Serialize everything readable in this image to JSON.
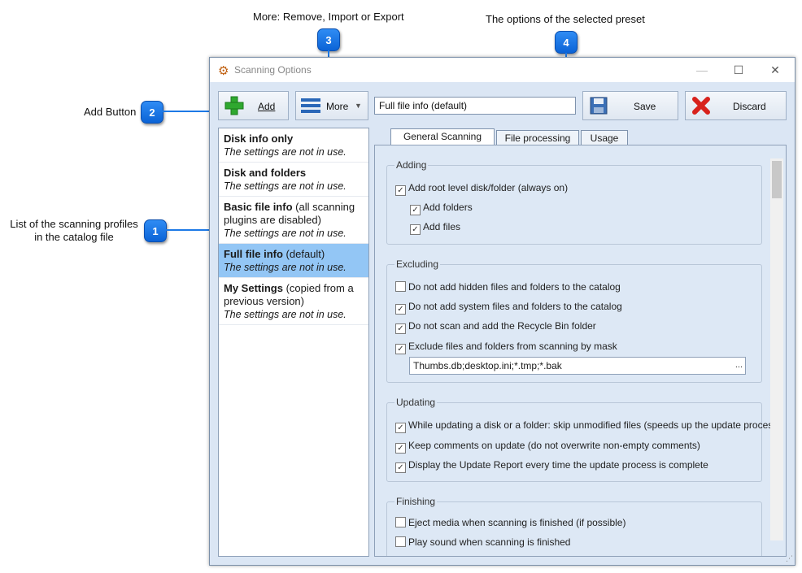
{
  "annotations": {
    "a1": {
      "num": "1",
      "label_line1": "List of the scanning profiles",
      "label_line2": "in the catalog file"
    },
    "a2": {
      "num": "2",
      "label": "Add Button"
    },
    "a3": {
      "num": "3",
      "label": "More: Remove, Import or Export"
    },
    "a4": {
      "num": "4",
      "label": "The options of the selected preset"
    }
  },
  "window": {
    "title": "Scanning Options",
    "minimize": "—",
    "maximize": "☐",
    "close": "✕"
  },
  "toolbar": {
    "add_label": "Add",
    "more_label": "More",
    "preset_name": "Full file info (default)",
    "save_label": "Save",
    "discard_label": "Discard"
  },
  "profiles": [
    {
      "name": "Disk info only",
      "suffix": "",
      "status": "The settings are not in use."
    },
    {
      "name": "Disk and folders",
      "suffix": "",
      "status": "The settings are not in use."
    },
    {
      "name": "Basic file info",
      "suffix": " (all scanning plugins are disabled)",
      "status": "The settings are not in use."
    },
    {
      "name": "Full file info",
      "suffix": " (default)",
      "status": "The settings are not in use."
    },
    {
      "name": "My Settings",
      "suffix": " (copied from a previous version)",
      "status": "The settings are not in use."
    }
  ],
  "tabs": [
    "General Scanning",
    "File processing",
    "Usage"
  ],
  "groups": {
    "adding": {
      "title": "Adding",
      "options": [
        {
          "label": "Add root level disk/folder (always on)",
          "checked": true
        },
        {
          "label": "Add folders",
          "checked": true
        },
        {
          "label": "Add files",
          "checked": true
        }
      ]
    },
    "excluding": {
      "title": "Excluding",
      "options": [
        {
          "label": "Do not add hidden files and folders to the catalog",
          "checked": false
        },
        {
          "label": "Do not add system files and folders to the catalog",
          "checked": true
        },
        {
          "label": "Do not scan and add the Recycle Bin folder",
          "checked": true
        },
        {
          "label": "Exclude files and folders from scanning by mask",
          "checked": true
        }
      ],
      "mask_value": "Thumbs.db;desktop.ini;*.tmp;*.bak",
      "mask_button": "..."
    },
    "updating": {
      "title": "Updating",
      "options": [
        {
          "label": "While updating a disk or a folder: skip unmodified files (speeds up the update process)",
          "checked": true
        },
        {
          "label": "Keep comments on update (do not overwrite non-empty comments)",
          "checked": true
        },
        {
          "label": "Display the Update Report every time the update process is complete",
          "checked": true
        }
      ]
    },
    "finishing": {
      "title": "Finishing",
      "options": [
        {
          "label": "Eject media when scanning is finished (if possible)",
          "checked": false
        },
        {
          "label": "Play sound when scanning is finished",
          "checked": false
        }
      ]
    }
  },
  "colors": {
    "accent": "#1d79e6",
    "selection": "#93c6f5",
    "window_bg": "#dbe6f4"
  }
}
